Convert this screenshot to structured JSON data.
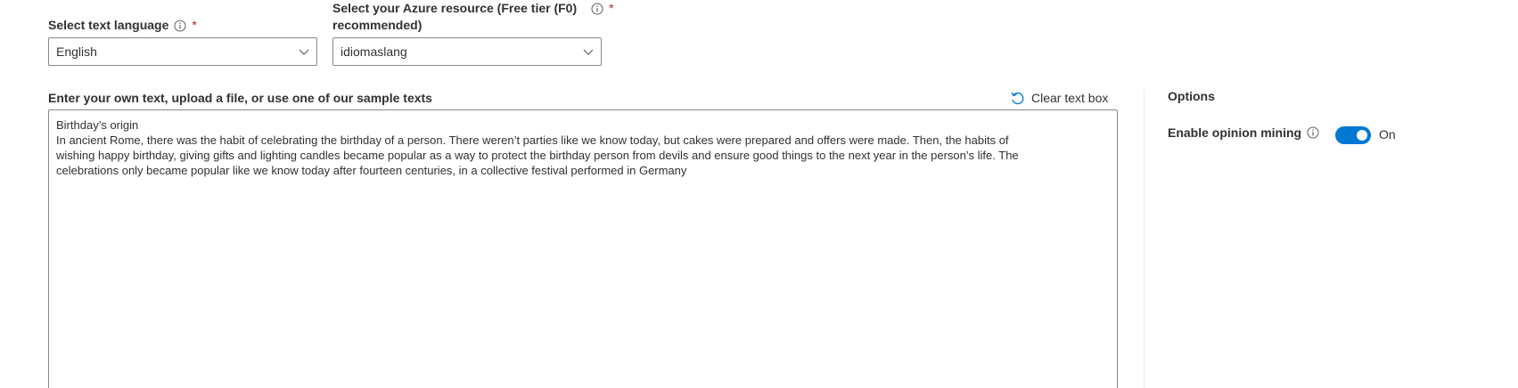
{
  "language": {
    "label": "Select text language",
    "required_mark": "*",
    "selected": "English"
  },
  "resource": {
    "label_line1": "Select your Azure resource (Free tier (F0)",
    "label_line2": "recommended)",
    "required_mark": "*",
    "selected": "idiomaslang"
  },
  "input": {
    "label": "Enter your own text, upload a file, or use one of our sample texts",
    "clear_label": "Clear text box",
    "text": "Birthday’s origin\nIn ancient Rome, there was the habit of celebrating the birthday of a person. There weren’t parties like we know today, but cakes were prepared and offers were made. Then, the habits of\nwishing happy birthday, giving gifts and lighting candles became popular as a way to protect the birthday person from devils and ensure good things to the next year in the person’s life. The\ncelebrations only became popular like we know today after fourteen centuries, in a collective festival performed in Germany"
  },
  "options": {
    "title": "Options",
    "opinion_label": "Enable opinion mining",
    "toggle_on": true,
    "toggle_text": "On"
  },
  "colors": {
    "accent": "#0078d4",
    "required": "#a4262c",
    "border": "#8a8886",
    "text": "#323130"
  }
}
